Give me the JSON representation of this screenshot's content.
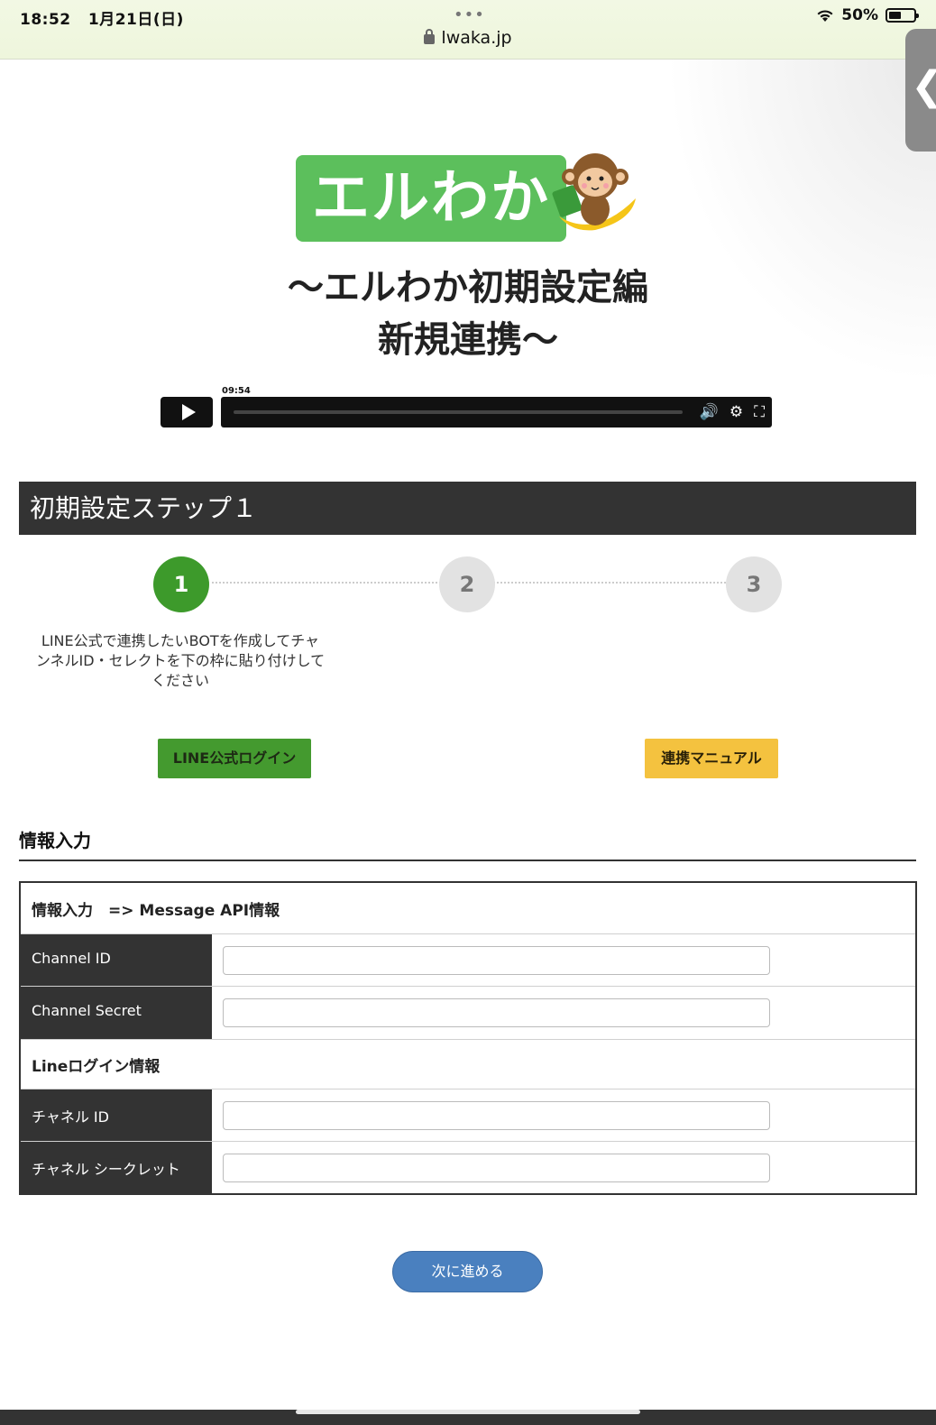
{
  "status_bar": {
    "time": "18:52",
    "date": "1月21日(日)",
    "battery": "50%",
    "url": "lwaka.jp"
  },
  "logo": {
    "text": "エルわか"
  },
  "video": {
    "title_line1": "～エルわか初期設定編",
    "title_line2": "新規連携～",
    "time": "09:54"
  },
  "step_header": "初期設定ステップ１",
  "steps": [
    {
      "number": "1",
      "active": true
    },
    {
      "number": "2",
      "active": false
    },
    {
      "number": "3",
      "active": false
    }
  ],
  "step_description": "LINE公式で連携したいBOTを作成してチャンネルID・セレクトを下の枠に貼り付けしてください",
  "buttons": {
    "line_login": "LINE公式ログイン",
    "manual": "連携マニュアル",
    "next": "次に進める"
  },
  "section_title": "情報入力",
  "form": {
    "group1": "情報入力　=> Message API情報",
    "channel_id_label": "Channel ID",
    "channel_id_value": "",
    "channel_secret_label": "Channel Secret",
    "channel_secret_value": "",
    "group2": "Lineログイン情報",
    "login_channel_id_label": "チャネル ID",
    "login_channel_id_value": "",
    "login_channel_secret_label": "チャネル シークレット",
    "login_channel_secret_value": ""
  },
  "colors": {
    "accent_green": "#449a2f",
    "accent_yellow": "#f4c23f",
    "next_blue": "#4a80bf",
    "header_dark": "#333333"
  }
}
